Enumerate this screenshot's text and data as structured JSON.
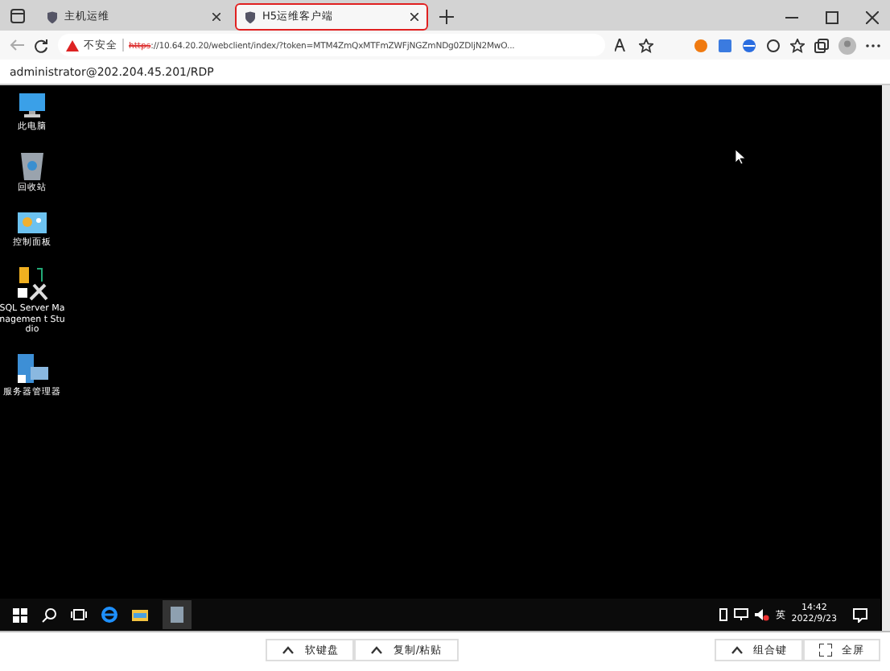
{
  "tabs": [
    {
      "label": "主机运维",
      "selected": false
    },
    {
      "label": "H5运维客户端",
      "selected": true
    }
  ],
  "address_bar": {
    "security": "不安全",
    "scheme": "https",
    "address": "://10.64.20.20/webclient/index/?token=MTM4ZmQxMTFmZWFjNGZmNDg0ZDljN2MwO..."
  },
  "session_title": "administrator@202.204.45.201/RDP",
  "desktop_icons": [
    {
      "kind": "computer",
      "label": "此电脑"
    },
    {
      "kind": "recycle",
      "label": "回收站"
    },
    {
      "kind": "control",
      "label": "控制面板"
    },
    {
      "kind": "sql",
      "label": "SQL Server Managemen t Studio"
    },
    {
      "kind": "server",
      "label": "服务器管理器"
    }
  ],
  "taskbar": {
    "ime": "英",
    "time": "14:42",
    "date": "2022/9/23"
  },
  "toolbar": {
    "left": [
      "软键盘",
      "复制/粘贴"
    ],
    "right": [
      {
        "kind": "caret",
        "label": "组合键"
      },
      {
        "kind": "fullscreen",
        "label": "全屏"
      }
    ]
  }
}
